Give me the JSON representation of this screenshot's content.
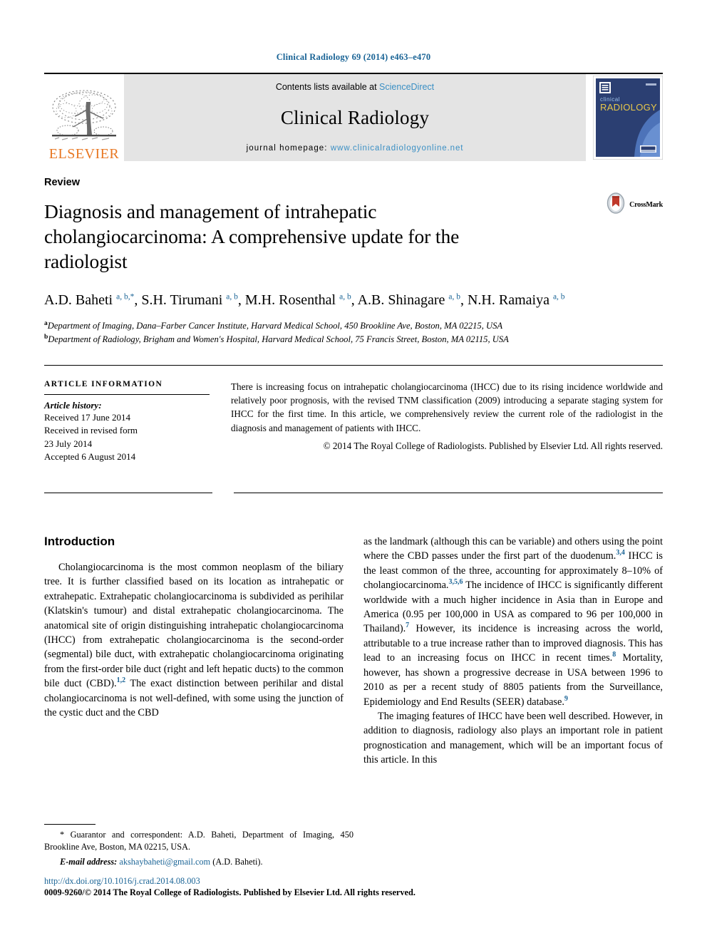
{
  "running_head": "Clinical Radiology 69 (2014) e463–e470",
  "masthead": {
    "publisher_name": "ELSEVIER",
    "contents_prefix": "Contents lists available at ",
    "contents_source": "ScienceDirect",
    "journal_name": "Clinical Radiology",
    "homepage_label": "journal homepage: ",
    "homepage_url": "www.clinicalradiologyonline.net",
    "cover_title_line1": "clinical",
    "cover_title_line2": "RADIOLOGY",
    "accent_link_color": "#3a8fc4",
    "elsevier_orange": "#e87722"
  },
  "article": {
    "doctype": "Review",
    "title": "Diagnosis and management of intrahepatic cholangiocarcinoma: A comprehensive update for the radiologist",
    "crossmark_label": "CrossMark",
    "authors_html": "A.D. Baheti <sup>a, b,</sup><sup>*</sup>, S.H. Tirumani <sup>a, b</sup>, M.H. Rosenthal <sup>a, b</sup>, A.B. Shinagare <sup>a, b</sup>, N.H. Ramaiya <sup>a, b</sup>",
    "affiliations": [
      {
        "marker": "a",
        "text": "Department of Imaging, Dana–Farber Cancer Institute, Harvard Medical School, 450 Brookline Ave, Boston, MA 02215, USA"
      },
      {
        "marker": "b",
        "text": "Department of Radiology, Brigham and Women's Hospital, Harvard Medical School, 75 Francis Street, Boston, MA 02115, USA"
      }
    ]
  },
  "article_information": {
    "heading": "ARTICLE INFORMATION",
    "history_label": "Article history:",
    "history_lines": [
      "Received 17 June 2014",
      "Received in revised form",
      "23 July 2014",
      "Accepted 6 August 2014"
    ],
    "abstract": "There is increasing focus on intrahepatic cholangiocarcinoma (IHCC) due to its rising incidence worldwide and relatively poor prognosis, with the revised TNM classification (2009) introducing a separate staging system for IHCC for the first time. In this article, we comprehensively review the current role of the radiologist in the diagnosis and management of patients with IHCC.",
    "copyright": "© 2014 The Royal College of Radiologists. Published by Elsevier Ltd. All rights reserved."
  },
  "body": {
    "left_column": {
      "section_heading": "Introduction",
      "paragraph_1_html": "Cholangiocarcinoma is the most common neoplasm of the biliary tree. It is further classified based on its location as intrahepatic or extrahepatic. Extrahepatic cholangiocarcinoma is subdivided as perihilar (Klatskin's tumour) and distal extrahepatic cholangiocarcinoma. The anatomical site of origin distinguishing intrahepatic cholangiocarcinoma (IHCC) from extrahepatic cholangiocarcinoma is the second-order (segmental) bile duct, with extrahepatic cholangiocarcinoma originating from the first-order bile duct (right and left hepatic ducts) to the common bile duct (CBD).<sup>1,2</sup> The exact distinction between perihilar and distal cholangiocarcinoma is not well-defined, with some using the junction of the cystic duct and the CBD"
    },
    "right_column": {
      "paragraph_1_html": "as the landmark (although this can be variable) and others using the point where the CBD passes under the first part of the duodenum.<sup>3,4</sup> IHCC is the least common of the three, accounting for approximately 8–10% of cholangiocarcinoma.<sup>3,5,6</sup> The incidence of IHCC is significantly different worldwide with a much higher incidence in Asia than in Europe and America (0.95 per 100,000 in USA as compared to 96 per 100,000 in Thailand).<sup>7</sup> However, its incidence is increasing across the world, attributable to a true increase rather than to improved diagnosis. This has lead to an increasing focus on IHCC in recent times.<sup>8</sup> Mortality, however, has shown a progressive decrease in USA between 1996 to 2010 as per a recent study of 8805 patients from the Surveillance, Epidemiology and End Results (SEER) database.<sup>9</sup>",
      "paragraph_2_html": "The imaging features of IHCC have been well described. However, in addition to diagnosis, radiology also plays an important role in patient prognostication and management, which will be an important focus of this article. In this"
    }
  },
  "footnotes": {
    "correspondence_html": "* Guarantor and correspondent: A.D. Baheti, Department of Imaging, 450 Brookline Ave, Boston, MA 02215, USA.",
    "email_label": "E-mail address:",
    "email_address": "akshaybaheti@gmail.com",
    "email_suffix": "(A.D. Baheti)."
  },
  "bottom_matter": {
    "doi": "http://dx.doi.org/10.1016/j.crad.2014.08.003",
    "issn_line": "0009-9260/© 2014 The Royal College of Radiologists. Published by Elsevier Ltd. All rights reserved."
  }
}
